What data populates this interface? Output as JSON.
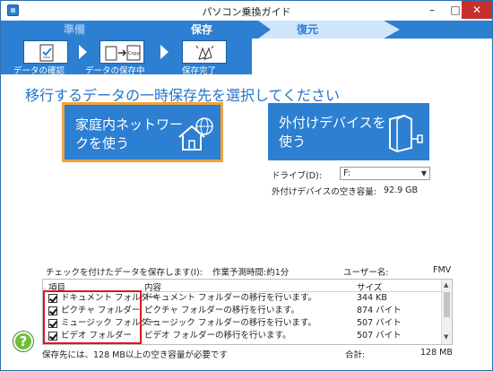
{
  "window": {
    "title": "パソコン乗換ガイド"
  },
  "steps": {
    "prep": "準備",
    "save": "保存",
    "restore": "復元"
  },
  "substeps": {
    "confirm": "データの確認",
    "saving": "データの保存中",
    "done": "保存完了",
    "copy_icon_text": "Copy"
  },
  "heading": "移行するデータの一時保存先を選択してください",
  "options": {
    "home_network": "家庭内ネットワークを使う",
    "external": "外付けデバイスを使う"
  },
  "drive": {
    "label": "ドライブ(D):",
    "selected": "F:",
    "free_label": "外付けデバイスの空き容量:",
    "free_value": "92.9 GB"
  },
  "summary": {
    "check_label": "チェックを付けたデータを保存します(I):",
    "time_label": "作業予測時間:約1分",
    "user_label": "ユーザー名:",
    "user_value": "FMV"
  },
  "table": {
    "headers": {
      "item": "項目",
      "content": "内容",
      "size": "サイズ"
    },
    "rows": [
      {
        "item": "ドキュメント フォルダー",
        "content": "ドキュメント フォルダーの移行を行います。",
        "size": "344 KB",
        "checked": true
      },
      {
        "item": "ピクチャ フォルダー",
        "content": "ピクチャ フォルダーの移行を行います。",
        "size": "874 バイト",
        "checked": true
      },
      {
        "item": "ミュージック フォルダー",
        "content": "ミュージック フォルダーの移行を行います。",
        "size": "507 バイト",
        "checked": true
      },
      {
        "item": "ビデオ フォルダー",
        "content": "ビデオ フォルダーの移行を行います。",
        "size": "507 バイト",
        "checked": true
      }
    ]
  },
  "footer": {
    "message": "保存先には、128 MB以上の空き容量が必要です",
    "total_label": "合計:",
    "total_value": "128 MB",
    "help_glyph": "?"
  },
  "colors": {
    "accent": "#2d7fd1",
    "highlight": "#f2a23a",
    "alert": "#e0141e",
    "help": "#6fbf3a"
  }
}
